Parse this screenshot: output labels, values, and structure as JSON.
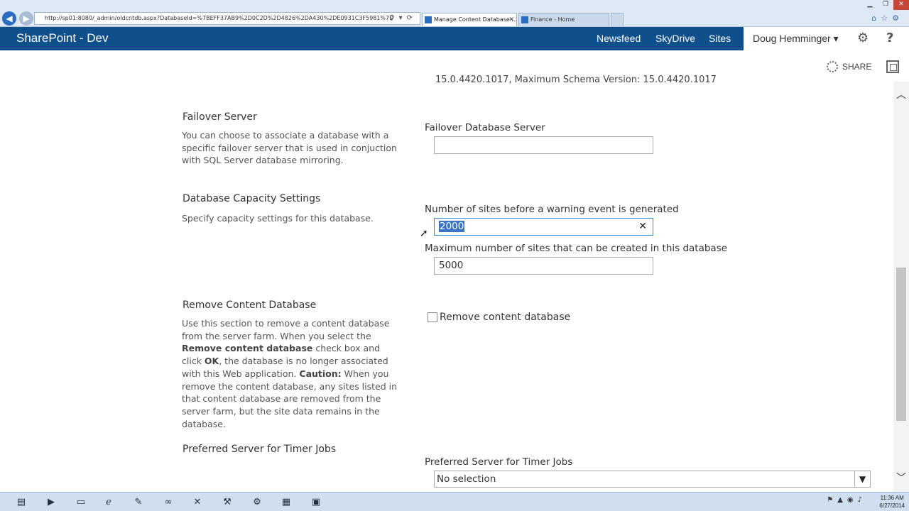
{
  "browser": {
    "address": "http://sp01:8080/_admin/oldcntdb.aspx?DatabaseId=%7BEFF37AB9%2D0C2D%2D4826%2DA430%2DE0931C3F5981%7D",
    "tabs": [
      {
        "label": "Manage Content Database ..."
      },
      {
        "label": "Finance - Home"
      }
    ]
  },
  "suitebar": {
    "brand": "SharePoint - Dev",
    "links": [
      "Newsfeed",
      "SkyDrive",
      "Sites"
    ],
    "user": "Doug Hemminger ▾"
  },
  "ribbon": {
    "share": "SHARE"
  },
  "content": {
    "cut_text": "15.0.4420.1017, Maximum Schema Version: 15.0.4420.1017",
    "failover": {
      "title": "Failover Server",
      "desc": "You can choose to associate a database with a specific failover server that is used in conjuction with SQL Server database mirroring.",
      "field_label": "Failover Database Server",
      "value": ""
    },
    "capacity": {
      "title": "Database Capacity Settings",
      "desc": "Specify capacity settings for this database.",
      "warn_label": "Number of sites before a warning event is generated",
      "warn_value": "2000",
      "max_label": "Maximum number of sites that can be created in this database",
      "max_value": "5000"
    },
    "remove": {
      "title": "Remove Content Database",
      "desc_1": "Use this section to remove a content database from the server farm. When you select the ",
      "desc_bold_1": "Remove content database",
      "desc_2": " check box and click ",
      "desc_bold_2": "OK",
      "desc_3": ", the database is no longer associated with this Web application. ",
      "desc_bold_3": "Caution:",
      "desc_4": " When you remove the content database, any sites listed in that content database are removed from the server farm, but the site data remains in the database.",
      "checkbox_label": "Remove content database"
    },
    "timer": {
      "title": "Preferred Server for Timer Jobs",
      "field_label": "Preferred Server for Timer Jobs",
      "selected": "No selection"
    }
  },
  "taskbar": {
    "time": "11:36 AM",
    "date": "6/27/2014"
  }
}
